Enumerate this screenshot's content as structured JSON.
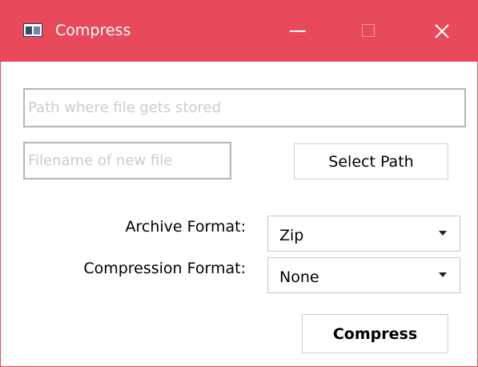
{
  "window": {
    "title": "Compress",
    "accent_color": "#e84a5c",
    "title_icon": "app-window-icon",
    "controls": [
      "minimize-icon",
      "maximize-icon",
      "close-icon"
    ]
  },
  "form": {
    "path_placeholder": "Path where file gets stored",
    "path_value": "",
    "filename_placeholder": "Filename of new file",
    "filename_value": "",
    "select_path_label": "Select Path",
    "archive_format_label": "Archive Format:",
    "archive_format_value": "Zip",
    "compression_format_label": "Compression Format:",
    "compression_format_value": "None",
    "compress_label": "Compress"
  }
}
